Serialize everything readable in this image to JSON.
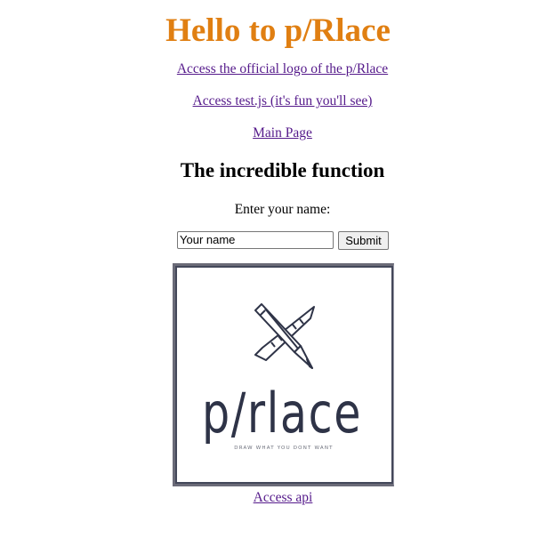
{
  "header": {
    "title": "Hello to p/Rlace"
  },
  "links": {
    "logo": "Access the official logo of the p/Rlace",
    "test": "Access test.js (it's fun you'll see)",
    "main": "Main Page",
    "api": "Access api"
  },
  "function_section": {
    "heading": "The incredible function",
    "prompt": "Enter your name:",
    "input_value": "",
    "input_placeholder": "Your name",
    "submit_label": "Submit"
  },
  "logo_image": {
    "wordmark": "p/rlace",
    "tagline": "DRAW WHAT YOU DONT WANT",
    "icons": [
      "pencil-icon",
      "ruler-icon"
    ]
  },
  "colors": {
    "title": "#e07f12",
    "link": "#551a8b",
    "logo_ink": "#2e3347"
  }
}
